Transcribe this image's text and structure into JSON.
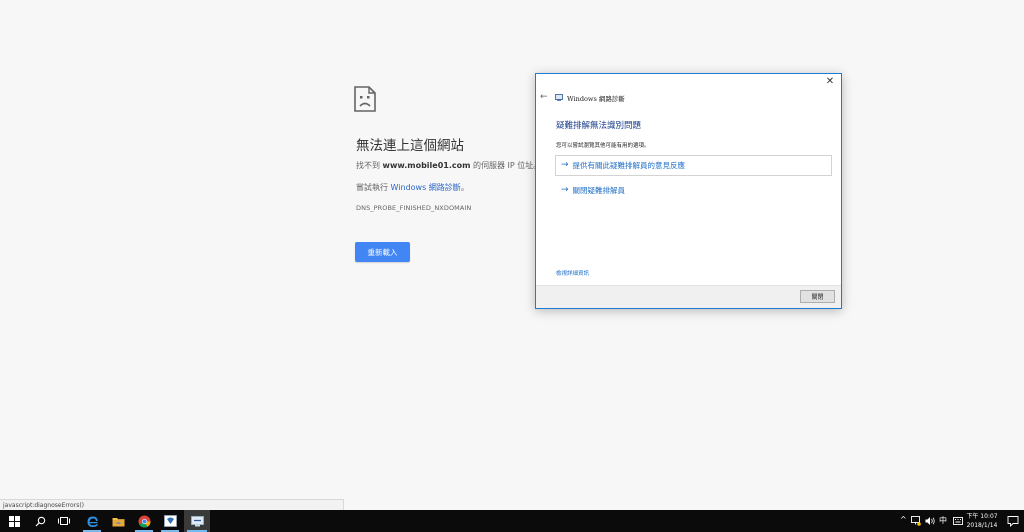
{
  "error_page": {
    "title": "無法連上這個網站",
    "desc_prefix": "找不到 ",
    "domain": "www.mobile01.com",
    "desc_suffix": " 的伺服器 IP 位址。",
    "suggest_prefix": "嘗試執行 ",
    "suggest_link": "Windows 網路診斷",
    "suggest_suffix": "。",
    "error_code": "DNS_PROBE_FINISHED_NXDOMAIN",
    "reload_label": "重新載入"
  },
  "dialog": {
    "title": "Windows 網路診斷",
    "heading": "疑難排解無法識別問題",
    "subtext": "您可以嘗試瀏覽其他可能有用的選項。",
    "options": [
      {
        "label": "提供有關此疑難排解員的意見反應"
      },
      {
        "label": "關閉疑難排解員"
      }
    ],
    "detail_link": "檢視詳細資訊",
    "close_button": "關閉"
  },
  "status_bar": {
    "url": "javascript:diagnoseErrors()"
  },
  "taskbar": {
    "ime": "中",
    "clock_period_time": "下午 10:07",
    "clock_date": "2018/1/14"
  },
  "colors": {
    "accent_blue": "#4285f4",
    "link_blue": "#1f6fc5",
    "taskbar_bg": "#0b0b0b"
  }
}
